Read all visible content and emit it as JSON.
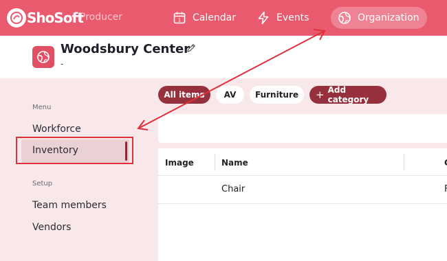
{
  "app": {
    "logo_text": "ShoSoft",
    "product_label": "Producer"
  },
  "nav": {
    "calendar": "Calendar",
    "events": "Events",
    "organization": "Organization"
  },
  "header": {
    "title": "Woodsbury Center",
    "subtitle": "-"
  },
  "sidebar": {
    "menu_heading": "Menu",
    "menu_items": [
      "Workforce",
      "Inventory"
    ],
    "active_item": "Inventory",
    "setup_heading": "Setup",
    "setup_items": [
      "Team members",
      "Vendors"
    ]
  },
  "categories": {
    "all": "All items",
    "av": "AV",
    "furniture": "Furniture",
    "add": "Add category"
  },
  "table": {
    "columns": [
      "Image",
      "Name",
      "C"
    ],
    "rows": [
      {
        "image": "",
        "name": "Chair",
        "extra": "F"
      }
    ]
  },
  "colors": {
    "brand": "#e95a6f",
    "accent": "#96303c",
    "annotation": "#e0303a"
  },
  "icons": {
    "calendar": "calendar-icon",
    "events": "lightning-icon",
    "organization": "globe-icon",
    "edit": "pencil-icon"
  }
}
